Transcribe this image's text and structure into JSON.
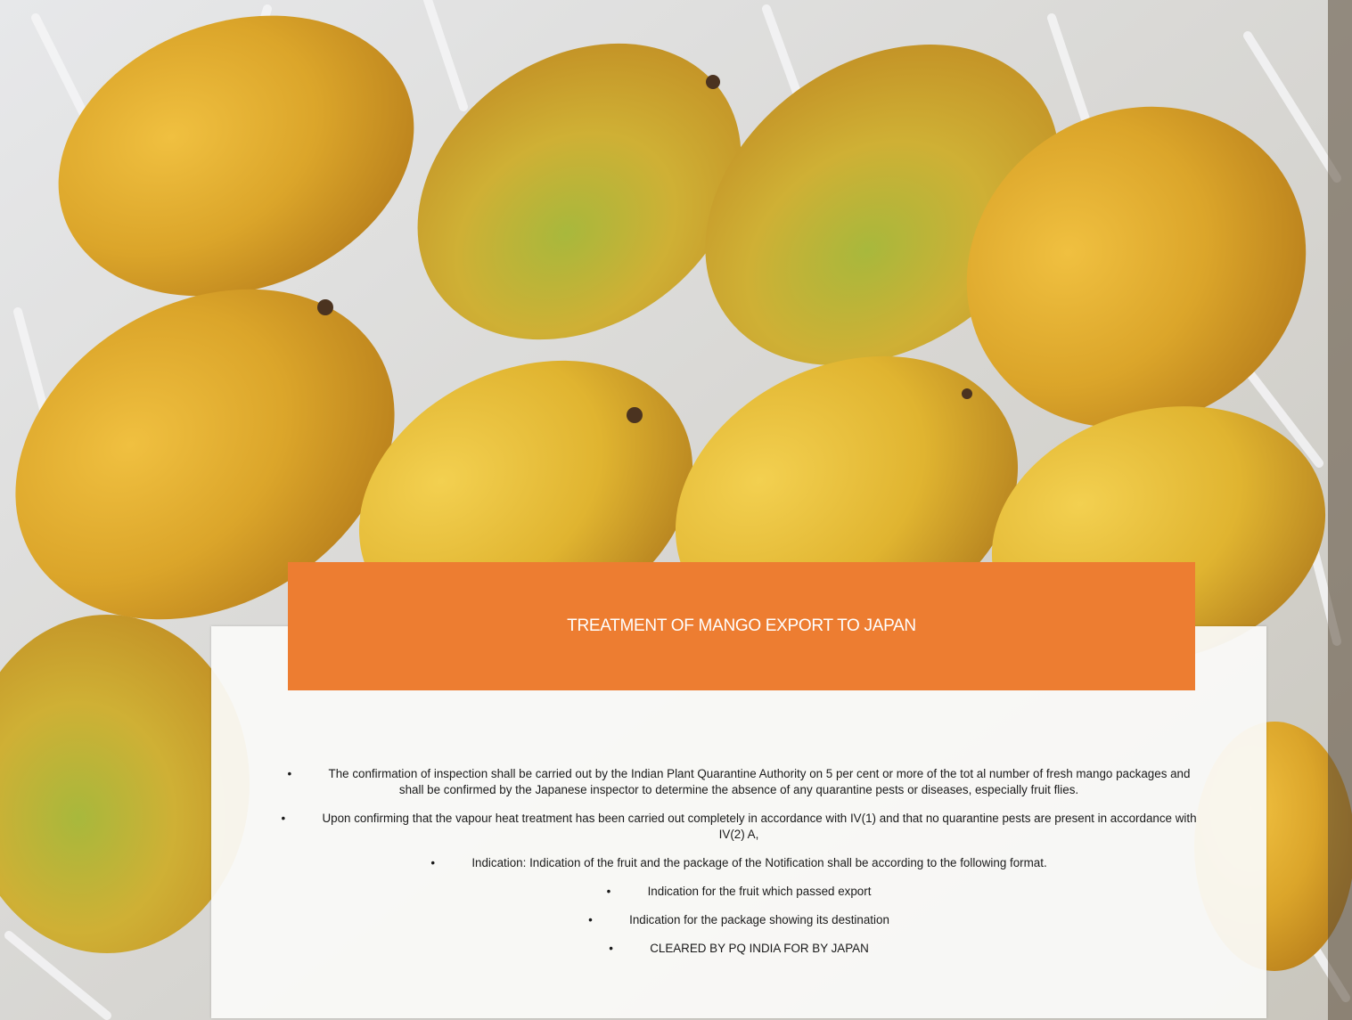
{
  "slide": {
    "title": "TREATMENT OF MANGO EXPORT TO JAPAN",
    "bullets": [
      "The confirmation of inspection shall be carried out by the Indian Plant Quarantine Authority on 5 per cent or more of the tot al number of fresh mango packages and shall be confirmed by the Japanese inspector to determine the absence of any quarantine pests or diseases, especially fruit flies.",
      "Upon confirming that the vapour heat treatment has been carried out completely in accordance with IV(1) and that no quarantine pests are present in accordance with IV(2) A,",
      "Indication: Indication of the fruit and the package of the Notification shall be according to the following format.",
      "Indication for the fruit which passed export",
      "Indication for the package showing its destination",
      "CLEARED BY PQ INDIA FOR BY JAPAN"
    ],
    "bullet_symbol": "•"
  },
  "colors": {
    "title_bar": "#ed7d31",
    "title_text": "#ffffff",
    "panel": "#fafaf8",
    "mango_yellow": "#e2a92c",
    "mango_green": "#8fae3a"
  },
  "background": {
    "icon": "mango-photo"
  }
}
